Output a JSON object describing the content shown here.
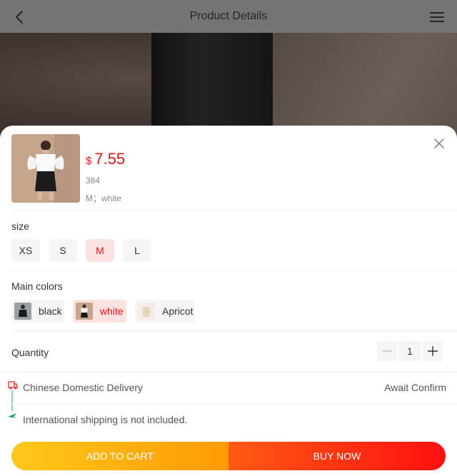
{
  "header": {
    "title": "Product Details",
    "back_icon": "chevron-left-icon",
    "menu_icon": "hamburger-menu-icon"
  },
  "product": {
    "currency": "$",
    "price": "7.55",
    "stock": "384",
    "selected": "M；white"
  },
  "size": {
    "label": "size",
    "options": [
      "XS",
      "S",
      "M",
      "L"
    ],
    "selected": "M"
  },
  "colors": {
    "label": "Main colors",
    "options": [
      "black",
      "white",
      "Apricot"
    ],
    "selected": "white"
  },
  "quantity": {
    "label": "Quantity",
    "value": "1"
  },
  "shipping": {
    "domestic_label": "Chinese Domestic Delivery",
    "domestic_status": "Await Confirm",
    "international_note": "International shipping is not included."
  },
  "actions": {
    "add_to_cart": "ADD TO CART",
    "buy_now": "BUY NOW"
  },
  "colors_theme": {
    "accent": "#e4141c",
    "cart_gradient": [
      "#ffc81a",
      "#ff9a05"
    ],
    "buy_gradient": [
      "#ff5a14",
      "#ff0f0f"
    ],
    "shipping_icon": "#e4141c",
    "plane_icon": "#1aaa55"
  }
}
